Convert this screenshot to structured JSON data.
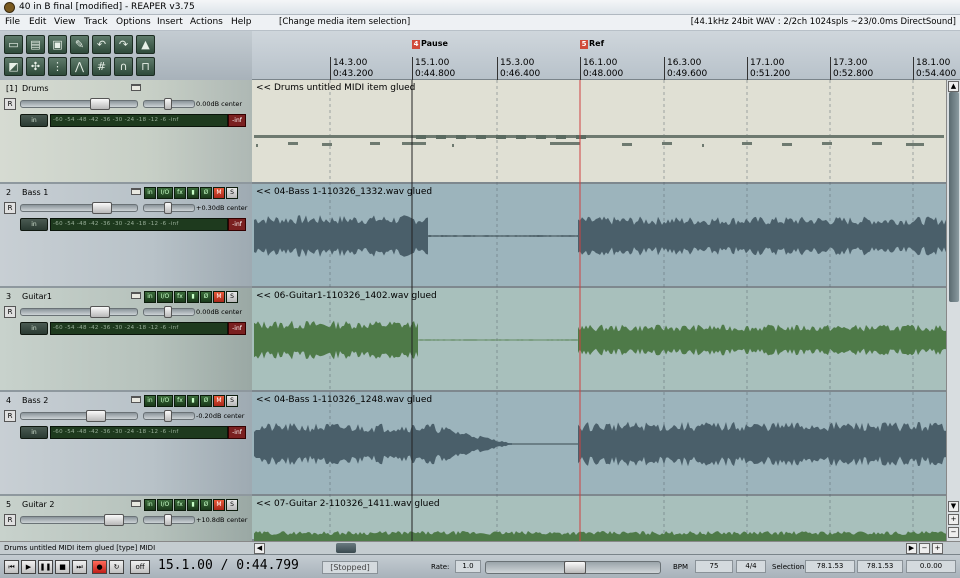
{
  "window": {
    "title": "40 in B final [modified] - REAPER v3.75"
  },
  "menu": {
    "items": [
      "File",
      "Edit",
      "View",
      "Track",
      "Options",
      "Insert",
      "Actions",
      "Help"
    ],
    "action_status": "[Change media item selection]",
    "audio_status": "[44.1kHz 24bit WAV : 2/2ch 1024spls ~23/0.0ms DirectSound]"
  },
  "toolbar": {
    "buttons": [
      "new-project",
      "open-project",
      "save-project",
      "project-settings",
      "undo",
      "redo",
      "metronome",
      "grid-toggle",
      "ripple-edit",
      "snap",
      "auto-crossfade",
      "lock",
      "envelope-lock",
      "item-lock"
    ]
  },
  "ruler": {
    "markers": [
      {
        "id": "4",
        "label": "Pause"
      },
      {
        "id": "5",
        "label": "Ref"
      }
    ],
    "ticks": [
      {
        "bar": "14.3.00",
        "time": "0:43.200"
      },
      {
        "bar": "15.1.00",
        "time": "0:44.800"
      },
      {
        "bar": "15.3.00",
        "time": "0:46.400"
      },
      {
        "bar": "16.1.00",
        "time": "0:48.000"
      },
      {
        "bar": "16.3.00",
        "time": "0:49.600"
      },
      {
        "bar": "17.1.00",
        "time": "0:51.200"
      },
      {
        "bar": "17.3.00",
        "time": "0:52.800"
      },
      {
        "bar": "18.1.00",
        "time": "0:54.400"
      }
    ]
  },
  "track_buttons": {
    "in": "in",
    "fx_pre": "fx",
    "io": "I/O",
    "fx": "fx",
    "phase": "Ø",
    "mute": "M",
    "solo": "S",
    "record_arm": "R",
    "input_button": "in"
  },
  "meter_scale": "-60  -54  -48  -42  -36  -30  -24  -18  -12  -6   -inf",
  "clip_label": "-inf",
  "tracks": [
    {
      "num": "[1]",
      "name": "Drums",
      "vol_text": "0.00dB center",
      "vol_level": 0.72,
      "item": "<< Drums untitled MIDI item glued"
    },
    {
      "num": "2",
      "name": "Bass 1",
      "vol_text": "+0.30dB center",
      "vol_level": 0.74,
      "item": "<< 04-Bass 1-110326_1332.wav glued"
    },
    {
      "num": "3",
      "name": "Guitar1",
      "vol_text": "0.00dB center",
      "vol_level": 0.72,
      "item": "<< 06-Guitar1-110326_1402.wav glued"
    },
    {
      "num": "4",
      "name": "Bass 2",
      "vol_text": "-0.20dB center",
      "vol_level": 0.68,
      "item": "<< 04-Bass 1-110326_1248.wav glued"
    },
    {
      "num": "5",
      "name": "Guitar 2",
      "vol_text": "+10.8dB center",
      "vol_level": 0.86,
      "item": "<< 07-Guitar 2-110326_1411.wav glued"
    }
  ],
  "info_bar": "Drums untitled MIDI item glued [type] MIDI",
  "transport": {
    "position": "15.1.00 / 0:44.799",
    "state": "[Stopped]",
    "off_label": "off",
    "rate_label": "Rate:",
    "rate_value": "1.0",
    "bpm_label": "BPM",
    "bpm_value": "75",
    "time_sig": "4/4",
    "selection_label": "Selection:",
    "sel_start": "78.1.53",
    "sel_end": "78.1.53",
    "sel_length": "0.0.00"
  },
  "colors": {
    "waveform_bass": "#4a5f6a",
    "waveform_guitar": "#4e7a48",
    "midi_notes": "#6e7a70",
    "lane_bass": "#9cb4bc",
    "lane_guitar": "#a8c0bc",
    "lane_drums": "#e0e0d4"
  }
}
